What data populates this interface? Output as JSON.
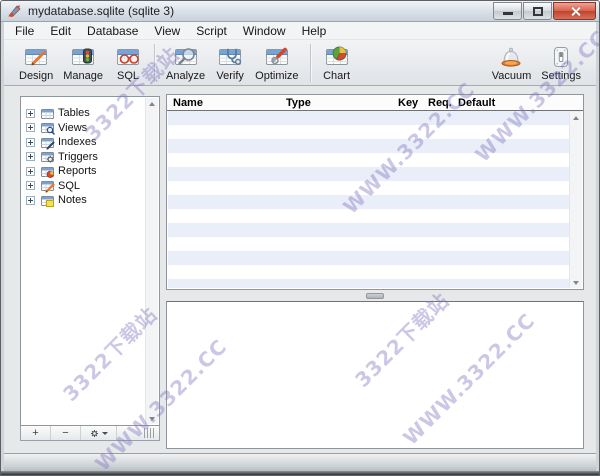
{
  "window": {
    "title": "mydatabase.sqlite (sqlite 3)"
  },
  "menu": {
    "items": [
      {
        "label": "File"
      },
      {
        "label": "Edit"
      },
      {
        "label": "Database"
      },
      {
        "label": "View"
      },
      {
        "label": "Script"
      },
      {
        "label": "Window"
      },
      {
        "label": "Help"
      }
    ]
  },
  "toolbar": {
    "left_items": [
      {
        "label": "Design",
        "icon": "design-icon"
      },
      {
        "label": "Manage",
        "icon": "manage-icon"
      },
      {
        "label": "SQL",
        "icon": "sql-icon"
      },
      {
        "label": "Analyze",
        "icon": "analyze-icon"
      },
      {
        "label": "Verify",
        "icon": "verify-icon"
      },
      {
        "label": "Optimize",
        "icon": "optimize-icon"
      },
      {
        "label": "Chart",
        "icon": "chart-icon"
      }
    ],
    "right_items": [
      {
        "label": "Vacuum",
        "icon": "vacuum-icon"
      },
      {
        "label": "Settings",
        "icon": "settings-icon"
      }
    ]
  },
  "sidebar": {
    "items": [
      {
        "label": "Tables",
        "icon": "tables-icon"
      },
      {
        "label": "Views",
        "icon": "views-icon"
      },
      {
        "label": "Indexes",
        "icon": "indexes-icon"
      },
      {
        "label": "Triggers",
        "icon": "triggers-icon"
      },
      {
        "label": "Reports",
        "icon": "reports-icon"
      },
      {
        "label": "SQL",
        "icon": "sql-tree-icon"
      },
      {
        "label": "Notes",
        "icon": "notes-icon"
      }
    ],
    "footer": {
      "add_label": "+",
      "remove_label": "−"
    }
  },
  "grid": {
    "columns": [
      {
        "label": "Name"
      },
      {
        "label": "Type"
      },
      {
        "label": "Key"
      },
      {
        "label": "Req."
      },
      {
        "label": "Default"
      }
    ],
    "rows": []
  },
  "watermarks": [
    {
      "text": "3322下载站"
    },
    {
      "text": "WWW.3322.CC"
    },
    {
      "text": "WWW.3322.CC"
    },
    {
      "text": "3322下载站"
    },
    {
      "text": "WWW.3322.CC"
    },
    {
      "text": "3322下载站"
    },
    {
      "text": "WWW.3322.CC"
    }
  ],
  "colors": {
    "stripe_blue": "#e9eef9",
    "watermark_purple": "#7e74bf",
    "close_button_red": "#c0432f",
    "table_icon_blue": "#7aa3d4",
    "titlebar_gradient_top": "#f0f4f8",
    "titlebar_gradient_bottom": "#c9d1da"
  }
}
